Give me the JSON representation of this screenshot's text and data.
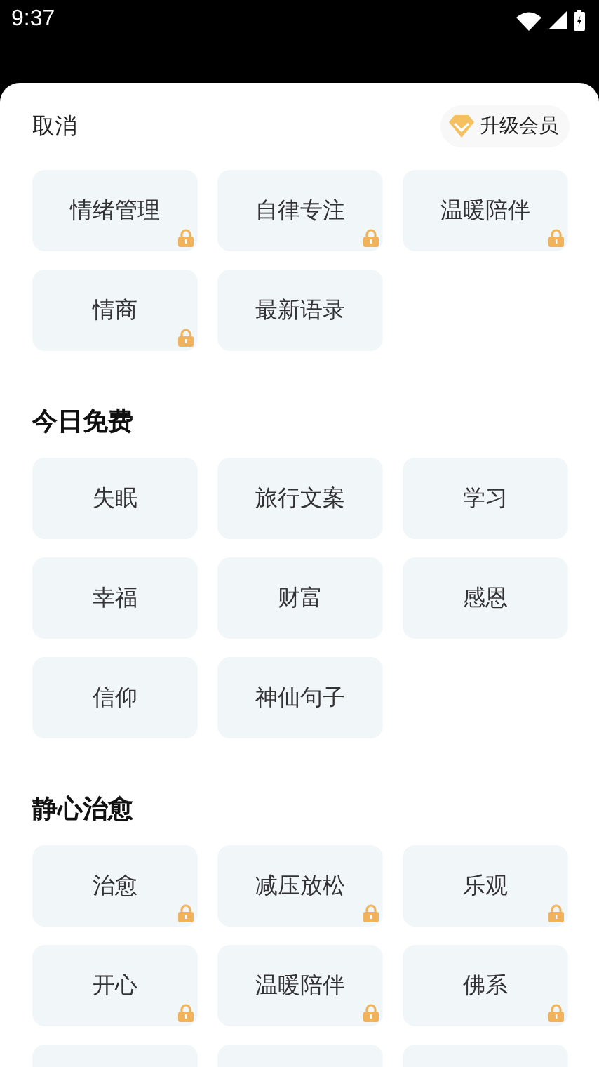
{
  "status_bar": {
    "time": "9:37"
  },
  "header": {
    "cancel": "取消",
    "upgrade": "升级会员"
  },
  "sections": [
    {
      "tiles": [
        {
          "label": "情绪管理",
          "locked": true
        },
        {
          "label": "自律专注",
          "locked": true
        },
        {
          "label": "温暖陪伴",
          "locked": true
        },
        {
          "label": "情商",
          "locked": true
        },
        {
          "label": "最新语录",
          "locked": false
        }
      ]
    },
    {
      "title": "今日免费",
      "tiles": [
        {
          "label": "失眠",
          "locked": false
        },
        {
          "label": "旅行文案",
          "locked": false
        },
        {
          "label": "学习",
          "locked": false
        },
        {
          "label": "幸福",
          "locked": false
        },
        {
          "label": "财富",
          "locked": false
        },
        {
          "label": "感恩",
          "locked": false
        },
        {
          "label": "信仰",
          "locked": false
        },
        {
          "label": "神仙句子",
          "locked": false
        }
      ]
    },
    {
      "title": "静心治愈",
      "tiles": [
        {
          "label": "治愈",
          "locked": true
        },
        {
          "label": "减压放松",
          "locked": true
        },
        {
          "label": "乐观",
          "locked": true
        },
        {
          "label": "开心",
          "locked": true
        },
        {
          "label": "温暖陪伴",
          "locked": true
        },
        {
          "label": "佛系",
          "locked": true
        }
      ],
      "next_row_cut_off": true
    }
  ]
}
